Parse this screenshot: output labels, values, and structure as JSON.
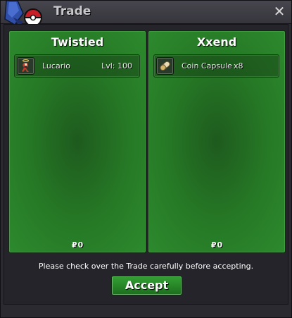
{
  "window": {
    "title": "Trade",
    "close_icon": "close-icon"
  },
  "colors": {
    "panel_green": "#267a26",
    "button_green": "#2a8a2a",
    "window_bg": "#2b2a31"
  },
  "left_panel": {
    "trader_name": "Twistied",
    "items": [
      {
        "name": "Lucario",
        "extra": "Lvl: 100",
        "icon": "lucario-sprite-icon"
      }
    ],
    "money_symbol": "₽",
    "money": "0"
  },
  "right_panel": {
    "trader_name": "Xxend",
    "items": [
      {
        "name": "Coin Capsule",
        "extra": "x8",
        "icon": "coin-capsule-icon"
      }
    ],
    "money_symbol": "₽",
    "money": "0"
  },
  "notice": "Please check over the Trade carefully before accepting.",
  "accept_label": "Accept"
}
